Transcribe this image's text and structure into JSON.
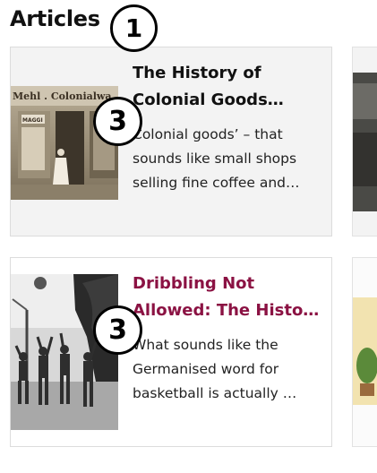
{
  "section": {
    "title": "Articles"
  },
  "badges": {
    "title_marker": "1",
    "card1_marker": "3",
    "card2_marker": "3"
  },
  "articles": [
    {
      "title": "The History of Colonial Goods…",
      "excerpt": "Colonial goods’ – that sounds like small shops selling fine coffee and…",
      "image_icon": "storefront-photo"
    },
    {
      "title": "Dribbling Not Allowed: The Histo…",
      "excerpt": "What sounds like the Germanised word for basketball is actually …",
      "image_icon": "basketball-photo"
    }
  ],
  "image_text": {
    "shop_sign": "Mehl . Colonialwa",
    "shop_sub": "MAGGI"
  },
  "colors": {
    "accent": "#8b1243",
    "card_bg": "#f3f3f3",
    "border": "#dcdcdc"
  }
}
